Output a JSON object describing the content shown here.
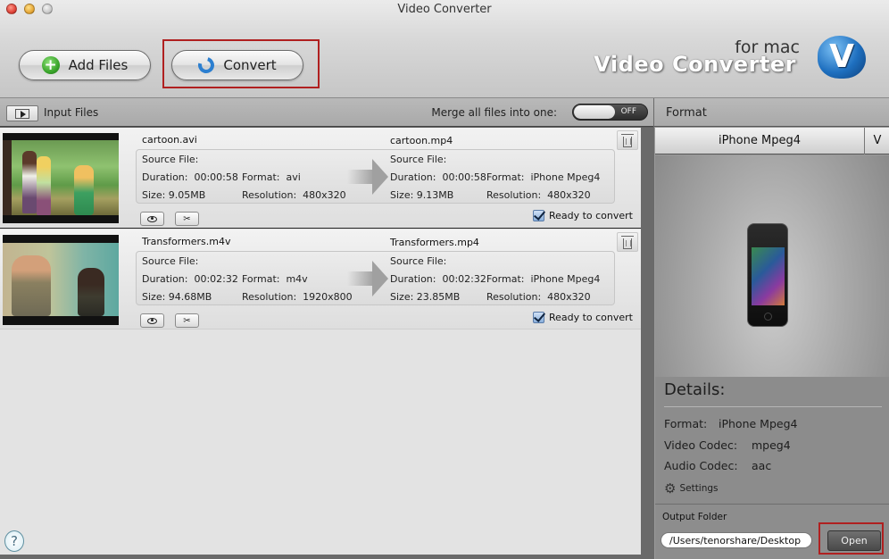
{
  "window": {
    "title": "Video Converter"
  },
  "toolbar": {
    "add_files_label": "Add Files",
    "convert_label": "Convert",
    "logo_small": "for mac",
    "logo_large": "Video Converter",
    "logo_badge": "V"
  },
  "list_header": {
    "input_files_label": "Input Files",
    "merge_label": "Merge all files into one:",
    "merge_toggle_state": "OFF"
  },
  "files": [
    {
      "source_name": "cartoon.avi",
      "source_heading": "Source File:",
      "source_duration": "Duration:  00:00:58",
      "source_format": "Format:  avi",
      "source_size": "Size: 9.05MB",
      "source_resolution": "Resolution:  480x320",
      "target_name": "cartoon.mp4",
      "target_heading": "Source File:",
      "target_duration": "Duration:  00:00:58",
      "target_format": "Format:  iPhone Mpeg4",
      "target_size": "Size: 9.13MB",
      "target_resolution": "Resolution:  480x320",
      "ready_label": "Ready to convert",
      "ready_checked": true
    },
    {
      "source_name": "Transformers.m4v",
      "source_heading": "Source File:",
      "source_duration": "Duration:  00:02:32",
      "source_format": "Format:  m4v",
      "source_size": "Size: 94.68MB",
      "source_resolution": "Resolution:  1920x800",
      "target_name": "Transformers.mp4",
      "target_heading": "Source File:",
      "target_duration": "Duration:  00:02:32",
      "target_format": "Format:  iPhone Mpeg4",
      "target_size": "Size: 23.85MB",
      "target_resolution": "Resolution:  480x320",
      "ready_label": "Ready to convert",
      "ready_checked": true
    }
  ],
  "right_panel": {
    "format_header": "Format",
    "format_selected": "iPhone Mpeg4",
    "format_caret": "V",
    "details_title": "Details:",
    "details": [
      {
        "label": "Format:",
        "value": "iPhone Mpeg4"
      },
      {
        "label": "Video Codec:",
        "value": "mpeg4"
      },
      {
        "label": "Audio Codec:",
        "value": "aac"
      }
    ],
    "settings_label": "Settings",
    "output_folder_label": "Output Folder",
    "output_folder_path": "/Users/tenorshare/Desktop",
    "open_label": "Open"
  },
  "help": {
    "glyph": "?"
  },
  "colors": {
    "highlight_box": "#b02020",
    "checkbox_blue": "#8ab0dc",
    "logo_blue": "#1e6fbf"
  }
}
